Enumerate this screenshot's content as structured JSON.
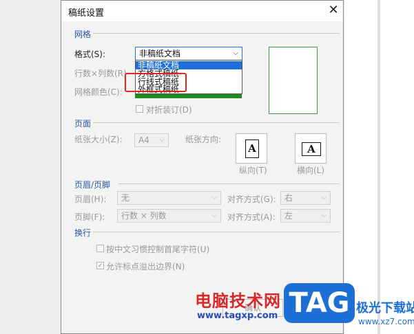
{
  "dialog": {
    "title": "稿纸设置",
    "close_glyph": "✕"
  },
  "grid_section": {
    "title": "网格",
    "format_label": "格式(S):",
    "format_value": "非稿纸文档",
    "rows_cols_label": "行数×列数(R)",
    "grid_color_label": "网格颜色(C):",
    "grid_color": "#1f8a1f",
    "fold_checkbox_label": "对折装订(D)",
    "fold_checked": false,
    "dropdown_options": [
      "非稿纸文档",
      "方格式稿纸",
      "行线式稿纸",
      "外框式稿纸"
    ],
    "dropdown_selected_index": 0
  },
  "page_section": {
    "title": "页面",
    "paper_size_label": "纸张大小(Z):",
    "paper_size_value": "A4",
    "orientation_label": "纸张方向:",
    "portrait_label": "纵向(T)",
    "landscape_label": "横向(L)",
    "page_glyph": "A"
  },
  "header_footer_section": {
    "title": "页眉/页脚",
    "header_label": "页眉(H):",
    "header_value": "无",
    "header_align_label": "对齐方式(G):",
    "header_align_value": "右",
    "footer_label": "页脚(F):",
    "footer_value": "行数 × 列数",
    "footer_align_label": "对齐方式(A):",
    "footer_align_value": "左"
  },
  "line_break_section": {
    "title": "换行",
    "option1_label": "按中文习惯控制首尾字符(U)",
    "option1_checked": false,
    "option2_label": "允许标点溢出边界(N)",
    "option2_checked": true
  },
  "buttons": {
    "ok_label": "确认"
  },
  "watermark": {
    "site_name": "电脑技术网",
    "site_url": "www.tagxp.com",
    "logo_text": "TAG",
    "site_name2": "极光下载站",
    "site_url2": "www.xz7.com"
  },
  "colors": {
    "accent": "#1e6fd9",
    "highlight_box": "#e02424",
    "preview_border": "#3a9a3a"
  }
}
